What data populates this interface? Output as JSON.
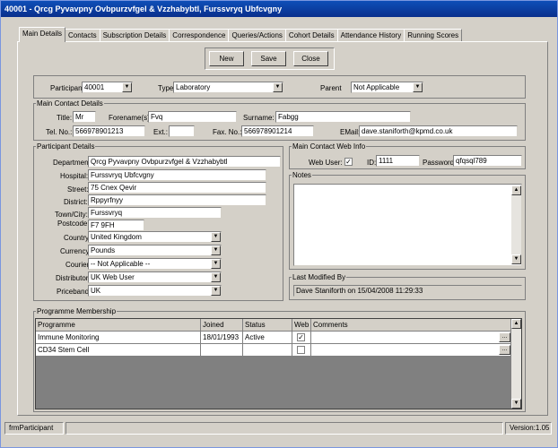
{
  "window": {
    "title": "40001 - Qrcg Pyvavpny Ovbpurzvfgel & Vzzhabybtl, Furssvryq Ubfcvgny"
  },
  "tabs": [
    "Main Details",
    "Contacts",
    "Subscription Details",
    "Correspondence",
    "Queries/Actions",
    "Cohort Details",
    "Attendance History",
    "Running Scores"
  ],
  "toolbar": {
    "new_label": "New",
    "save_label": "Save",
    "close_label": "Close"
  },
  "participant": {
    "participant_label": "Participant",
    "participant_value": "40001",
    "type_label": "Type",
    "type_value": "Laboratory",
    "parent_label": "Parent",
    "parent_value": "Not Applicable"
  },
  "main_contact": {
    "legend": "Main Contact Details",
    "title_label": "Title:",
    "title_value": "Mr",
    "forenames_label": "Forename(s):",
    "forenames_value": "Fvq",
    "surname_label": "Surname:",
    "surname_value": "Fabgg",
    "tel_label": "Tel. No.:",
    "tel_value": "566978901213",
    "ext_label": "Ext.:",
    "ext_value": "",
    "fax_label": "Fax. No.:",
    "fax_value": "566978901214",
    "email_label": "EMail:",
    "email_value": "dave.staniforth@kpmd.co.uk"
  },
  "participant_details": {
    "legend": "Participant Details",
    "department_label": "Department:",
    "department_value": "Qrcg Pyvavpny Ovbpurzvfgel & Vzzhabybtl",
    "hospital_label": "Hospital:",
    "hospital_value": "Furssvryq Ubfcvgny",
    "street_label": "Street:",
    "street_value": "75 Cnex Qevir",
    "district_label": "District:",
    "district_value": "Rppyrfnyy",
    "town_label": "Town/City:",
    "town_value": "Furssvryq",
    "postcode_label": "Postcode:",
    "postcode_value": "F7 9FH",
    "country_label": "Country:",
    "country_value": "United Kingdom",
    "currency_label": "Currency:",
    "currency_value": "Pounds",
    "courier_label": "Courier:",
    "courier_value": "-- Not Applicable --",
    "distributor_label": "Distributor:",
    "distributor_value": "UK Web User",
    "priceband_label": "Priceband:",
    "priceband_value": "UK"
  },
  "web_info": {
    "legend": "Main Contact Web Info",
    "web_user_label": "Web User:",
    "web_user_checked": true,
    "id_label": "ID:",
    "id_value": "1111",
    "password_label": "Password:",
    "password_value": "qfqsql789"
  },
  "notes": {
    "legend": "Notes",
    "value": ""
  },
  "last_modified": {
    "legend": "Last Modified By",
    "value": "Dave Staniforth on 15/04/2008 11:29:33"
  },
  "programme": {
    "legend": "Programme Membership",
    "columns": [
      "Programme",
      "Joined",
      "Status",
      "Web",
      "Comments"
    ],
    "rows": [
      {
        "programme": "Immune Monitoring",
        "joined": "18/01/1993",
        "status": "Active",
        "web": true,
        "comments": ""
      },
      {
        "programme": "CD34 Stem Cell",
        "joined": "",
        "status": "",
        "web": false,
        "comments": ""
      }
    ]
  },
  "statusbar": {
    "form_name": "frmParticipant",
    "version": "Version:1.05"
  },
  "icons": {
    "dropdown": "chevron-down-icon",
    "ellipsis": "ellipsis-icon",
    "check": "checkmark-icon"
  }
}
